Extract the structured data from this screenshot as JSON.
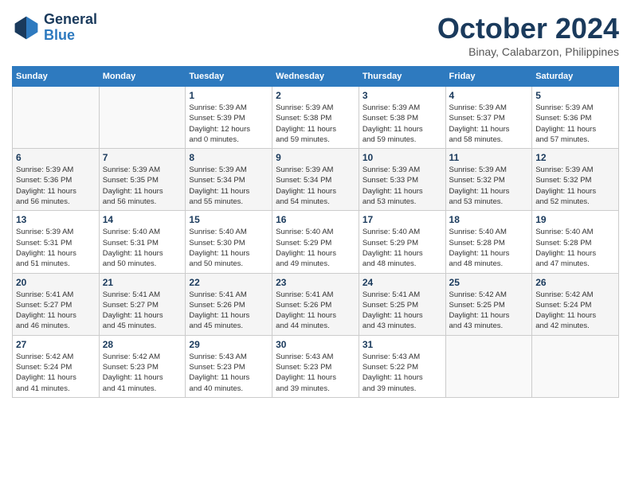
{
  "logo": {
    "line1": "General",
    "line2": "Blue"
  },
  "title": "October 2024",
  "location": "Binay, Calabarzon, Philippines",
  "weekdays": [
    "Sunday",
    "Monday",
    "Tuesday",
    "Wednesday",
    "Thursday",
    "Friday",
    "Saturday"
  ],
  "weeks": [
    [
      {
        "day": "",
        "info": ""
      },
      {
        "day": "",
        "info": ""
      },
      {
        "day": "1",
        "info": "Sunrise: 5:39 AM\nSunset: 5:39 PM\nDaylight: 12 hours\nand 0 minutes."
      },
      {
        "day": "2",
        "info": "Sunrise: 5:39 AM\nSunset: 5:38 PM\nDaylight: 11 hours\nand 59 minutes."
      },
      {
        "day": "3",
        "info": "Sunrise: 5:39 AM\nSunset: 5:38 PM\nDaylight: 11 hours\nand 59 minutes."
      },
      {
        "day": "4",
        "info": "Sunrise: 5:39 AM\nSunset: 5:37 PM\nDaylight: 11 hours\nand 58 minutes."
      },
      {
        "day": "5",
        "info": "Sunrise: 5:39 AM\nSunset: 5:36 PM\nDaylight: 11 hours\nand 57 minutes."
      }
    ],
    [
      {
        "day": "6",
        "info": "Sunrise: 5:39 AM\nSunset: 5:36 PM\nDaylight: 11 hours\nand 56 minutes."
      },
      {
        "day": "7",
        "info": "Sunrise: 5:39 AM\nSunset: 5:35 PM\nDaylight: 11 hours\nand 56 minutes."
      },
      {
        "day": "8",
        "info": "Sunrise: 5:39 AM\nSunset: 5:34 PM\nDaylight: 11 hours\nand 55 minutes."
      },
      {
        "day": "9",
        "info": "Sunrise: 5:39 AM\nSunset: 5:34 PM\nDaylight: 11 hours\nand 54 minutes."
      },
      {
        "day": "10",
        "info": "Sunrise: 5:39 AM\nSunset: 5:33 PM\nDaylight: 11 hours\nand 53 minutes."
      },
      {
        "day": "11",
        "info": "Sunrise: 5:39 AM\nSunset: 5:32 PM\nDaylight: 11 hours\nand 53 minutes."
      },
      {
        "day": "12",
        "info": "Sunrise: 5:39 AM\nSunset: 5:32 PM\nDaylight: 11 hours\nand 52 minutes."
      }
    ],
    [
      {
        "day": "13",
        "info": "Sunrise: 5:39 AM\nSunset: 5:31 PM\nDaylight: 11 hours\nand 51 minutes."
      },
      {
        "day": "14",
        "info": "Sunrise: 5:40 AM\nSunset: 5:31 PM\nDaylight: 11 hours\nand 50 minutes."
      },
      {
        "day": "15",
        "info": "Sunrise: 5:40 AM\nSunset: 5:30 PM\nDaylight: 11 hours\nand 50 minutes."
      },
      {
        "day": "16",
        "info": "Sunrise: 5:40 AM\nSunset: 5:29 PM\nDaylight: 11 hours\nand 49 minutes."
      },
      {
        "day": "17",
        "info": "Sunrise: 5:40 AM\nSunset: 5:29 PM\nDaylight: 11 hours\nand 48 minutes."
      },
      {
        "day": "18",
        "info": "Sunrise: 5:40 AM\nSunset: 5:28 PM\nDaylight: 11 hours\nand 48 minutes."
      },
      {
        "day": "19",
        "info": "Sunrise: 5:40 AM\nSunset: 5:28 PM\nDaylight: 11 hours\nand 47 minutes."
      }
    ],
    [
      {
        "day": "20",
        "info": "Sunrise: 5:41 AM\nSunset: 5:27 PM\nDaylight: 11 hours\nand 46 minutes."
      },
      {
        "day": "21",
        "info": "Sunrise: 5:41 AM\nSunset: 5:27 PM\nDaylight: 11 hours\nand 45 minutes."
      },
      {
        "day": "22",
        "info": "Sunrise: 5:41 AM\nSunset: 5:26 PM\nDaylight: 11 hours\nand 45 minutes."
      },
      {
        "day": "23",
        "info": "Sunrise: 5:41 AM\nSunset: 5:26 PM\nDaylight: 11 hours\nand 44 minutes."
      },
      {
        "day": "24",
        "info": "Sunrise: 5:41 AM\nSunset: 5:25 PM\nDaylight: 11 hours\nand 43 minutes."
      },
      {
        "day": "25",
        "info": "Sunrise: 5:42 AM\nSunset: 5:25 PM\nDaylight: 11 hours\nand 43 minutes."
      },
      {
        "day": "26",
        "info": "Sunrise: 5:42 AM\nSunset: 5:24 PM\nDaylight: 11 hours\nand 42 minutes."
      }
    ],
    [
      {
        "day": "27",
        "info": "Sunrise: 5:42 AM\nSunset: 5:24 PM\nDaylight: 11 hours\nand 41 minutes."
      },
      {
        "day": "28",
        "info": "Sunrise: 5:42 AM\nSunset: 5:23 PM\nDaylight: 11 hours\nand 41 minutes."
      },
      {
        "day": "29",
        "info": "Sunrise: 5:43 AM\nSunset: 5:23 PM\nDaylight: 11 hours\nand 40 minutes."
      },
      {
        "day": "30",
        "info": "Sunrise: 5:43 AM\nSunset: 5:23 PM\nDaylight: 11 hours\nand 39 minutes."
      },
      {
        "day": "31",
        "info": "Sunrise: 5:43 AM\nSunset: 5:22 PM\nDaylight: 11 hours\nand 39 minutes."
      },
      {
        "day": "",
        "info": ""
      },
      {
        "day": "",
        "info": ""
      }
    ]
  ]
}
